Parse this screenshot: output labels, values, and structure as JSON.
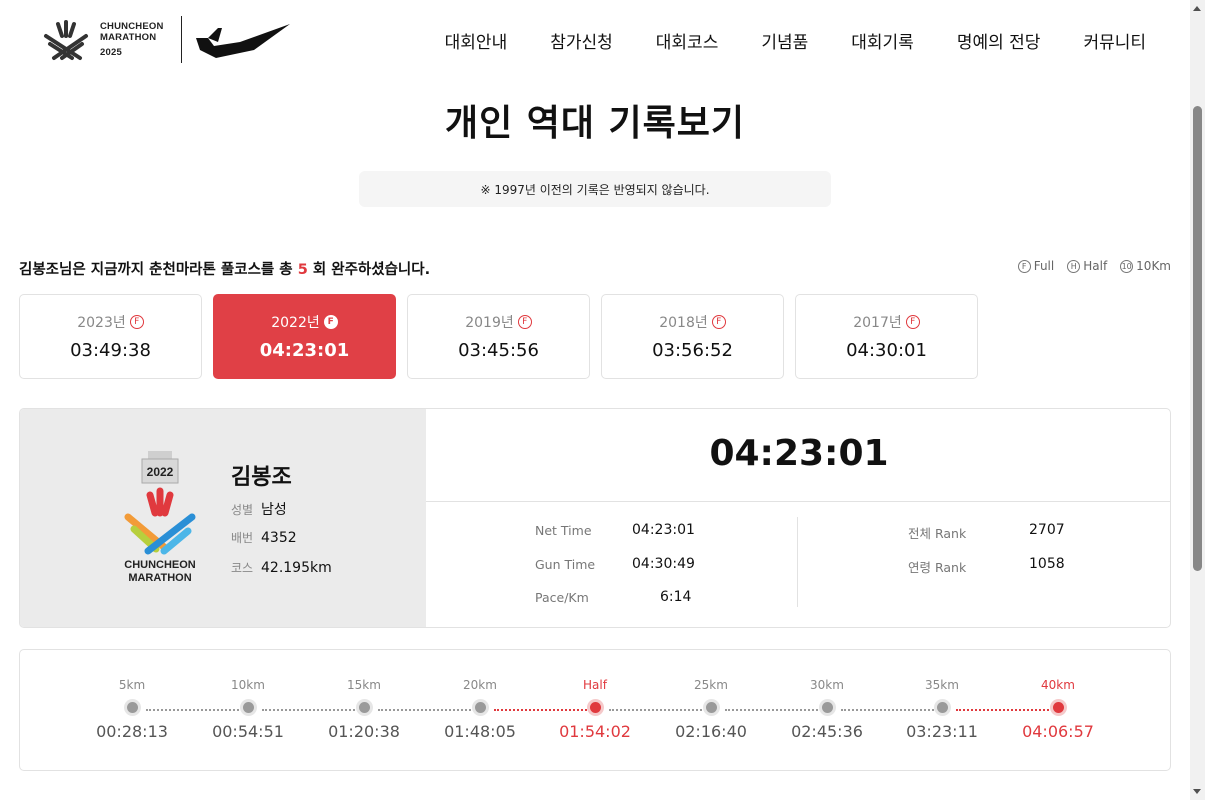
{
  "header": {
    "logo_line1": "CHUNCHEON",
    "logo_line2": "MARATHON",
    "logo_year": "2025",
    "nav": [
      "대회안내",
      "참가신청",
      "대회코스",
      "기념품",
      "대회기록",
      "명예의 전당",
      "커뮤니티"
    ]
  },
  "page_title": "개인 역대 기록보기",
  "notice": "※ 1997년 이전의 기록은 반영되지 않습니다.",
  "summary": {
    "before": "김봉조님은 지금까지 춘천마라톤 풀코스를 총 ",
    "count": "5",
    "after": " 회 완주하셨습니다."
  },
  "legend": [
    {
      "icon": "F",
      "label": "Full"
    },
    {
      "icon": "H",
      "label": "Half"
    },
    {
      "icon": "10",
      "label": "10Km"
    }
  ],
  "records": [
    {
      "year": "2023년",
      "badge": "F",
      "time": "03:49:38",
      "active": false
    },
    {
      "year": "2022년",
      "badge": "F",
      "time": "04:23:01",
      "active": true
    },
    {
      "year": "2019년",
      "badge": "F",
      "time": "03:45:56",
      "active": false
    },
    {
      "year": "2018년",
      "badge": "F",
      "time": "03:56:52",
      "active": false
    },
    {
      "year": "2017년",
      "badge": "F",
      "time": "04:30:01",
      "active": false
    }
  ],
  "detail": {
    "medal_year": "2022",
    "medal_line1": "CHUNCHEON",
    "medal_line2": "MARATHON",
    "name": "김봉조",
    "gender_label": "성별",
    "gender": "남성",
    "bib_label": "배번",
    "bib": "4352",
    "course_label": "코스",
    "course": "42.195km",
    "finish_time": "04:23:01",
    "net_time_label": "Net Time",
    "net_time": "04:23:01",
    "gun_time_label": "Gun Time",
    "gun_time": "04:30:49",
    "pace_label": "Pace/Km",
    "pace": "6:14",
    "overall_rank_label": "전체 Rank",
    "overall_rank": "2707",
    "age_rank_label": "연령 Rank",
    "age_rank": "1058"
  },
  "splits": [
    {
      "label": "5km",
      "time": "00:28:13",
      "highlight": false
    },
    {
      "label": "10km",
      "time": "00:54:51",
      "highlight": false
    },
    {
      "label": "15km",
      "time": "01:20:38",
      "highlight": false
    },
    {
      "label": "20km",
      "time": "01:48:05",
      "highlight": false
    },
    {
      "label": "Half",
      "time": "01:54:02",
      "highlight": true
    },
    {
      "label": "25km",
      "time": "02:16:40",
      "highlight": false
    },
    {
      "label": "30km",
      "time": "02:45:36",
      "highlight": false
    },
    {
      "label": "35km",
      "time": "03:23:11",
      "highlight": false
    },
    {
      "label": "40km",
      "time": "04:06:57",
      "highlight": true
    }
  ],
  "colors": {
    "accent": "#e0393e",
    "panel_gray": "#ebebeb"
  }
}
